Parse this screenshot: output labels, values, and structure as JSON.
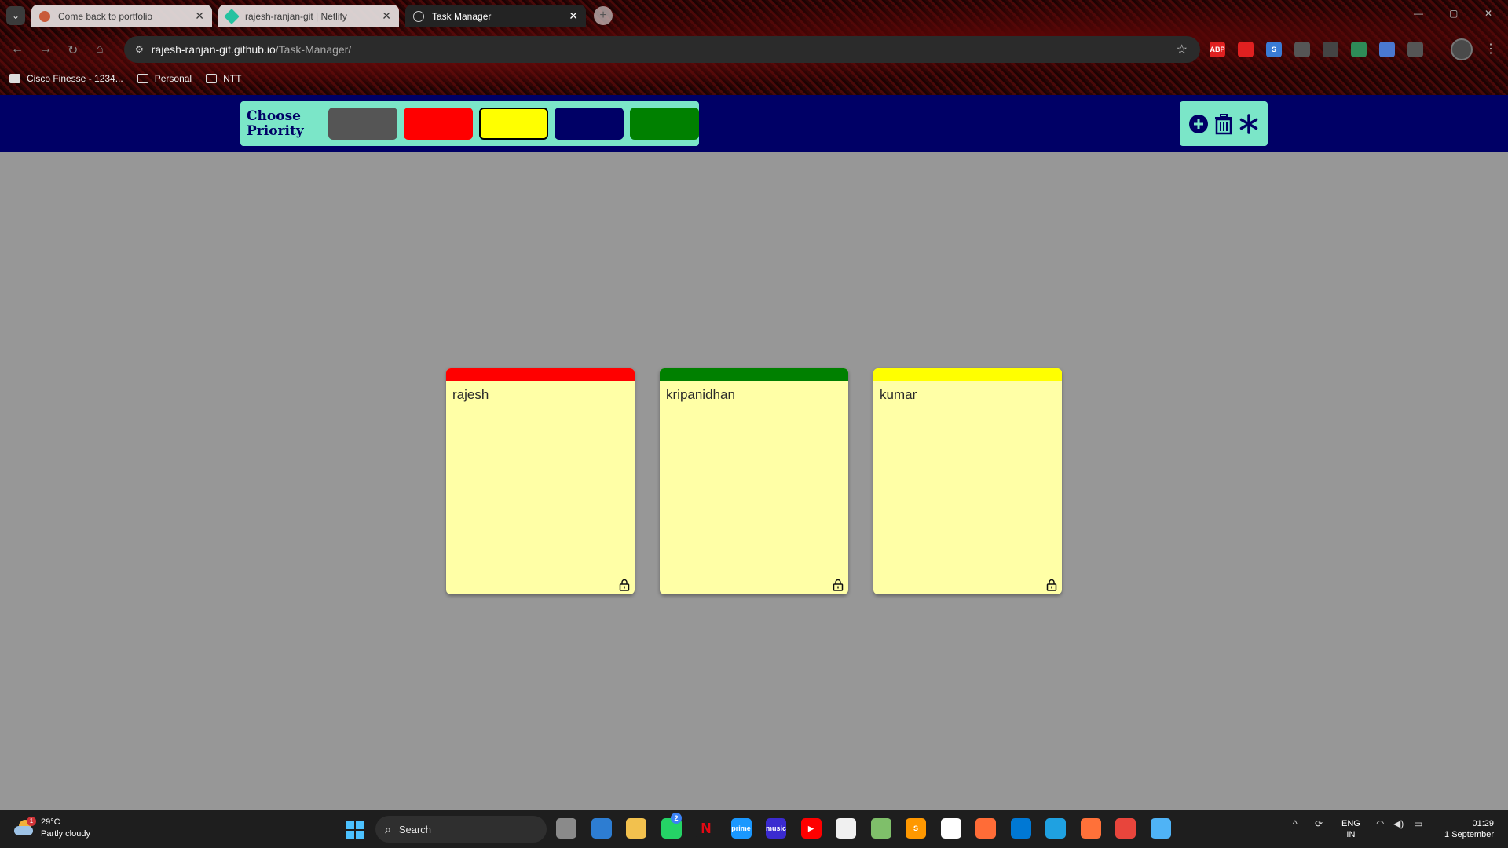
{
  "browser": {
    "tabs": [
      {
        "title": "Come back to portfolio",
        "active": false,
        "favicon_color": "#c85a3a"
      },
      {
        "title": "rajesh-ranjan-git | Netlify",
        "active": false,
        "favicon_color": "#25c2a0"
      },
      {
        "title": "Task Manager",
        "active": true,
        "favicon_color": "#cccccc"
      }
    ],
    "tab_close_glyph": "✕",
    "new_tab_glyph": "+",
    "url_host": "rajesh-ranjan-git.github.io",
    "url_path": "/Task-Manager/",
    "bookmarks": [
      {
        "label": "Cisco Finesse - 1234...",
        "icon": "cisco-icon"
      },
      {
        "label": "Personal",
        "icon": "folder-icon"
      },
      {
        "label": "NTT",
        "icon": "folder-icon"
      }
    ],
    "extensions": [
      {
        "name": "adblock-icon",
        "label": "ABP",
        "color": "#e02020"
      },
      {
        "name": "extension-red-icon",
        "label": "",
        "color": "#e02020"
      },
      {
        "name": "extension-s-icon",
        "label": "S",
        "color": "#3a7bd5"
      },
      {
        "name": "extension-target-icon",
        "label": "",
        "color": "#555555"
      },
      {
        "name": "extension-react-icon",
        "label": "",
        "color": "#444444"
      },
      {
        "name": "extension-globe-icon",
        "label": "",
        "color": "#2e8b57"
      },
      {
        "name": "extension-doc-icon",
        "label": "",
        "color": "#4a78d0"
      },
      {
        "name": "extensions-puzzle-icon",
        "label": "",
        "color": "#555555"
      }
    ]
  },
  "app": {
    "priority_title": "Choose\nPriority",
    "priority_colors": [
      {
        "name": "grey",
        "color": "#555555",
        "selected": false
      },
      {
        "name": "red",
        "color": "#ff0000",
        "selected": false
      },
      {
        "name": "yellow",
        "color": "#ffff00",
        "selected": true
      },
      {
        "name": "navy",
        "color": "#000066",
        "selected": false
      },
      {
        "name": "green",
        "color": "#008000",
        "selected": false
      }
    ],
    "actions": [
      "add-icon",
      "delete-icon",
      "asterisk-icon"
    ],
    "accent": "#000066",
    "panel_bg": "#7be6c8"
  },
  "cards": [
    {
      "text": "rajesh",
      "band_color": "#ff0000",
      "icon": "lock-icon"
    },
    {
      "text": "kripanidhan",
      "band_color": "#008000",
      "icon": "lock-icon"
    },
    {
      "text": "kumar",
      "band_color": "#ffff00",
      "icon": "lock-icon"
    }
  ],
  "taskbar": {
    "weather_temp": "29°C",
    "weather_desc": "Partly cloudy",
    "weather_badge": "1",
    "search_label": "Search",
    "whatsapp_badge": "2",
    "lang_1": "ENG",
    "lang_2": "IN",
    "time": "01:29",
    "date": "1 September",
    "apps": [
      {
        "name": "task-view-icon",
        "label": "",
        "color": "#8a8a8a"
      },
      {
        "name": "store-icon",
        "label": "",
        "color": "#2d7dd2"
      },
      {
        "name": "file-explorer-icon",
        "label": "",
        "color": "#f2c14e"
      },
      {
        "name": "whatsapp-icon",
        "label": "",
        "color": "#25d366"
      },
      {
        "name": "netflix-icon",
        "label": "N",
        "color": "#1e1e1e"
      },
      {
        "name": "prime-video-icon",
        "label": "prime",
        "color": "#1a98ff"
      },
      {
        "name": "amazon-music-icon",
        "label": "music",
        "color": "#3b2bd0"
      },
      {
        "name": "youtube-icon",
        "label": "▶",
        "color": "#ff0000"
      },
      {
        "name": "github-icon",
        "label": "",
        "color": "#f0f0f0"
      },
      {
        "name": "notepad-icon",
        "label": "",
        "color": "#7fbf6a"
      },
      {
        "name": "sublime-text-icon",
        "label": "S",
        "color": "#ff9800"
      },
      {
        "name": "mongodb-icon",
        "label": "",
        "color": "#ffffff"
      },
      {
        "name": "postman-icon",
        "label": "",
        "color": "#ff6c37"
      },
      {
        "name": "vscode-icon",
        "label": "",
        "color": "#0078d4"
      },
      {
        "name": "edge-icon",
        "label": "",
        "color": "#1fa1e1"
      },
      {
        "name": "firefox-icon",
        "label": "",
        "color": "#ff7139"
      },
      {
        "name": "chrome-icon",
        "label": "",
        "color": "#e8453c"
      },
      {
        "name": "paint-icon",
        "label": "",
        "color": "#4fb3f6"
      }
    ]
  }
}
